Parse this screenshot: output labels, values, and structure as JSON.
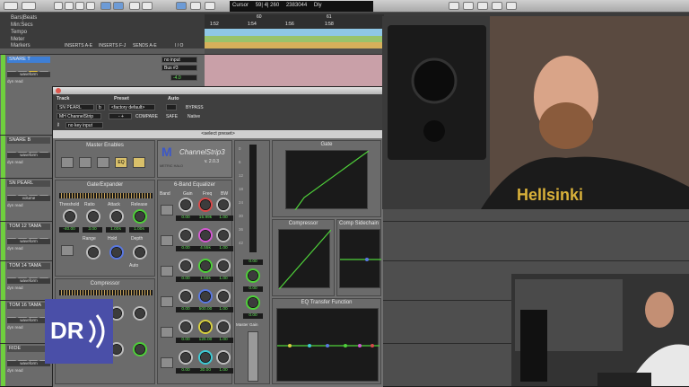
{
  "transport": {
    "cursor_label": "Cursor",
    "cursor_value": "59| 4| 260",
    "samples": "2383044",
    "mode_label": "Dly"
  },
  "rulers": {
    "rows": [
      "Bars|Beats",
      "Min:Secs",
      "Tempo",
      "Meter",
      "Markers"
    ],
    "bar_ticks": [
      "60",
      "61"
    ],
    "time_ticks": [
      "1:52",
      "1:54",
      "1:56",
      "1:58"
    ]
  },
  "track_columns": {
    "inserts_ae": "INSERTS A-E",
    "inserts_fj": "INSERTS F-J",
    "sends_ae": "SENDS A-E",
    "io": "I / O"
  },
  "tracks": [
    {
      "name": "SNARE T",
      "selected": true,
      "view": "waveform",
      "io_in": "no input",
      "io_out": "Bus #3",
      "vol": "-4.0"
    },
    {
      "name": "SNARE B",
      "selected": false,
      "view": "waveform",
      "io_in": "",
      "io_out": "",
      "vol": ""
    },
    {
      "name": "SN PEARL",
      "selected": false,
      "view": "volume",
      "io_in": "",
      "io_out": "",
      "vol": ""
    },
    {
      "name": "TOM 12 TAMA",
      "selected": false,
      "view": "waveform",
      "io_in": "",
      "io_out": "",
      "vol": ""
    },
    {
      "name": "TOM 14 TAMA",
      "selected": false,
      "view": "waveform",
      "io_in": "",
      "io_out": "",
      "vol": ""
    },
    {
      "name": "TOM 16 TAMA",
      "selected": false,
      "view": "waveform",
      "io_in": "",
      "io_out": "",
      "vol": ""
    },
    {
      "name": "RIDE",
      "selected": false,
      "view": "waveform",
      "io_in": "",
      "io_out": "",
      "vol": ""
    }
  ],
  "track_buttons": {
    "dyn": "dyn",
    "read": "read"
  },
  "plugin": {
    "track_label": "Track",
    "preset_label": "Preset",
    "auto_label": "Auto",
    "track_name": "SN PEARL",
    "track_suffix": "b",
    "preset_value": "<factory default>",
    "plugin_name": "MH ChannelStrip",
    "compare_label": "COMPARE",
    "bypass_label": "BYPASS",
    "safe_label": "SAFE",
    "native_label": "Native",
    "key_input": "no key input",
    "select_preset": "<select preset>",
    "logo_text": "ChannelStrip3",
    "logo_version": "v. 2.0.3",
    "logo_brand": "METRIC HALO",
    "master_enables_title": "Master Enables",
    "gate_title": "Gate/Expander",
    "gate_labels": [
      "Threshold",
      "Ratio",
      "Attack",
      "Release"
    ],
    "gate_vals": [
      "-40.00",
      "3.00",
      "1.00s",
      "1.00s"
    ],
    "gate_extra_labels": [
      "Range",
      "Hold",
      "Depth"
    ],
    "gate_mode": "Auto",
    "comp_title": "Compressor",
    "eq_title": "6-Band Equalizer",
    "eq_head": [
      "Band",
      "Gain",
      "Freq",
      "BW"
    ],
    "eq_bands": [
      {
        "gain": "0.00",
        "freq": "15.99k",
        "bw": "1.00"
      },
      {
        "gain": "0.00",
        "freq": "4.55k",
        "bw": "1.00"
      },
      {
        "gain": "0.00",
        "freq": "1.56k",
        "bw": "1.00"
      },
      {
        "gain": "0.00",
        "freq": "500.00",
        "bw": "1.00"
      },
      {
        "gain": "0.00",
        "freq": "125.00",
        "bw": "1.00"
      },
      {
        "gain": "0.00",
        "freq": "30.00",
        "bw": "1.00"
      }
    ],
    "gate_graph_title": "Gate",
    "comp_graph_title": "Compressor",
    "sidechain_title": "Comp Sidechain",
    "eq_graph_title": "EQ Transfer Function",
    "master_gain_label": "Master Gain",
    "output_vals": [
      "0.00",
      "0.00",
      "0.00"
    ],
    "meter_ticks": [
      "0",
      "6",
      "12",
      "18",
      "24",
      "30",
      "36",
      "42"
    ],
    "graph_y_ticks": [
      "24",
      "18",
      "12",
      "6",
      "0",
      "-6",
      "-12",
      "-18"
    ],
    "graph_x_ticks": [
      "80",
      "60",
      "40",
      "20",
      "0"
    ],
    "freq_ticks": [
      "100",
      "1k",
      "10k"
    ],
    "eq_y_ticks": [
      "24",
      "12",
      "0",
      "-12",
      "-24"
    ]
  },
  "logo": {
    "text": "DR"
  },
  "colors": {
    "accent_green": "#63e35a",
    "brand_blue": "#4a4fa8",
    "selected_track": "#3e7fd6",
    "region_pink": "#c9a0a8"
  }
}
